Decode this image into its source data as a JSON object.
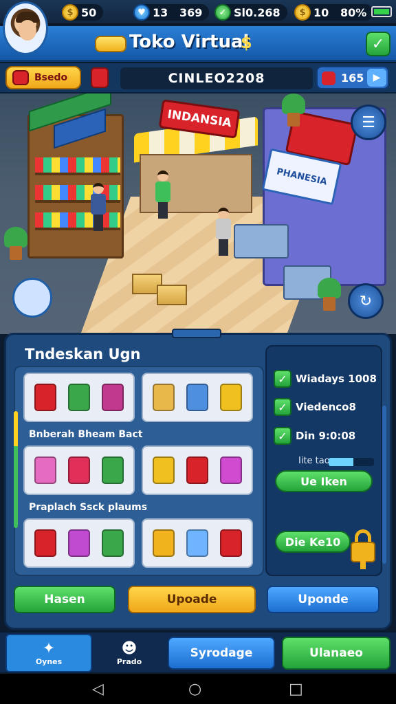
{
  "status": {
    "coins": "50",
    "gems": "13",
    "gems_total": "369",
    "cash": "Sl0.268",
    "gold": "10",
    "battery": "80%"
  },
  "header": {
    "title": "Toko Virtual",
    "title_symbol": "$",
    "close_icon": "check-icon"
  },
  "subbar": {
    "badge_label": "Bsedo",
    "store_id": "CINLEO2208",
    "right_value": "165",
    "arrow": "▶"
  },
  "scene": {
    "stall_sign": "INDANSIA",
    "banner_text": "PHANESIA",
    "menu_icon": "☰",
    "refresh_icon": "↻"
  },
  "panel": {
    "title": "Tndeskan Ugn",
    "categories": [
      "Bnberah Bheam Bact",
      "Praplach Ssck plaums"
    ],
    "product_colors": [
      [
        "#d8232a",
        "#3aa84a",
        "#c0398e",
        "#e8b84a",
        "#4f8fe0",
        "#f0c020"
      ],
      [
        "#e46bbf",
        "#e0305a",
        "#3aa84a",
        "#f0c020",
        "#d8232a",
        "#d04bd0"
      ],
      [
        "#d8232a",
        "#c04bd0",
        "#3aa84a",
        "#f0b21d",
        "#6fb4ff",
        "#d8232a"
      ]
    ]
  },
  "side": {
    "checks": [
      "Wiadays 1008",
      "Viedenco8",
      "Din 9:0:08"
    ],
    "progress_label": "Iite taovs",
    "progress_pct": 55,
    "button1": "Ue Iken",
    "button2": "Die Ke10"
  },
  "actions": {
    "hasten": "Hasen",
    "upgrade": "Upoade",
    "upgrade2": "Uponde"
  },
  "nav": {
    "tab1_label": "Oynes",
    "tab1_icon": "✦",
    "tab2_label": "Prado",
    "tab2_icon": "☻",
    "mid_button": "Syrodage",
    "right_button": "Ulanaeo"
  },
  "android": {
    "back": "◁",
    "home": "○",
    "recents": "□"
  }
}
